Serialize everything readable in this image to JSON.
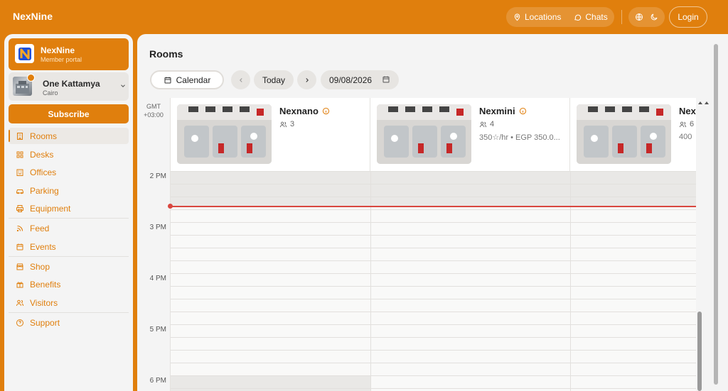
{
  "topbar": {
    "brand": "NexNine",
    "locations_label": "Locations",
    "chats_label": "Chats",
    "login_label": "Login"
  },
  "sidebar": {
    "member_name": "NexNine",
    "member_sub": "Member portal",
    "location_name": "One Kattamya",
    "location_city": "Cairo",
    "subscribe_label": "Subscribe",
    "items": [
      {
        "label": "Rooms",
        "icon": "building-icon",
        "active": true
      },
      {
        "label": "Desks",
        "icon": "grid-icon"
      },
      {
        "label": "Offices",
        "icon": "office-icon"
      },
      {
        "label": "Parking",
        "icon": "car-icon"
      },
      {
        "label": "Equipment",
        "icon": "printer-icon"
      },
      {
        "label": "Feed",
        "icon": "rss-icon"
      },
      {
        "label": "Events",
        "icon": "calendar-icon"
      },
      {
        "label": "Shop",
        "icon": "shop-icon"
      },
      {
        "label": "Benefits",
        "icon": "gift-icon"
      },
      {
        "label": "Visitors",
        "icon": "users-icon"
      },
      {
        "label": "Support",
        "icon": "help-icon"
      }
    ]
  },
  "main": {
    "title": "Rooms",
    "calendar_label": "Calendar",
    "today_label": "Today",
    "date_value": "09/08/2026",
    "tz_line1": "GMT",
    "tz_line2": "+03:00",
    "rooms": [
      {
        "name": "Nexnano",
        "capacity": "3",
        "price": ""
      },
      {
        "name": "Nexmini",
        "capacity": "4",
        "price": "350☆/hr • EGP 350.0..."
      },
      {
        "name": "Nex",
        "capacity": "6",
        "price": "400"
      }
    ],
    "hours": [
      "2 PM",
      "3 PM",
      "4 PM",
      "5 PM",
      "6 PM"
    ]
  },
  "colors": {
    "accent": "#e07f0d",
    "now_line": "#d9473f"
  }
}
